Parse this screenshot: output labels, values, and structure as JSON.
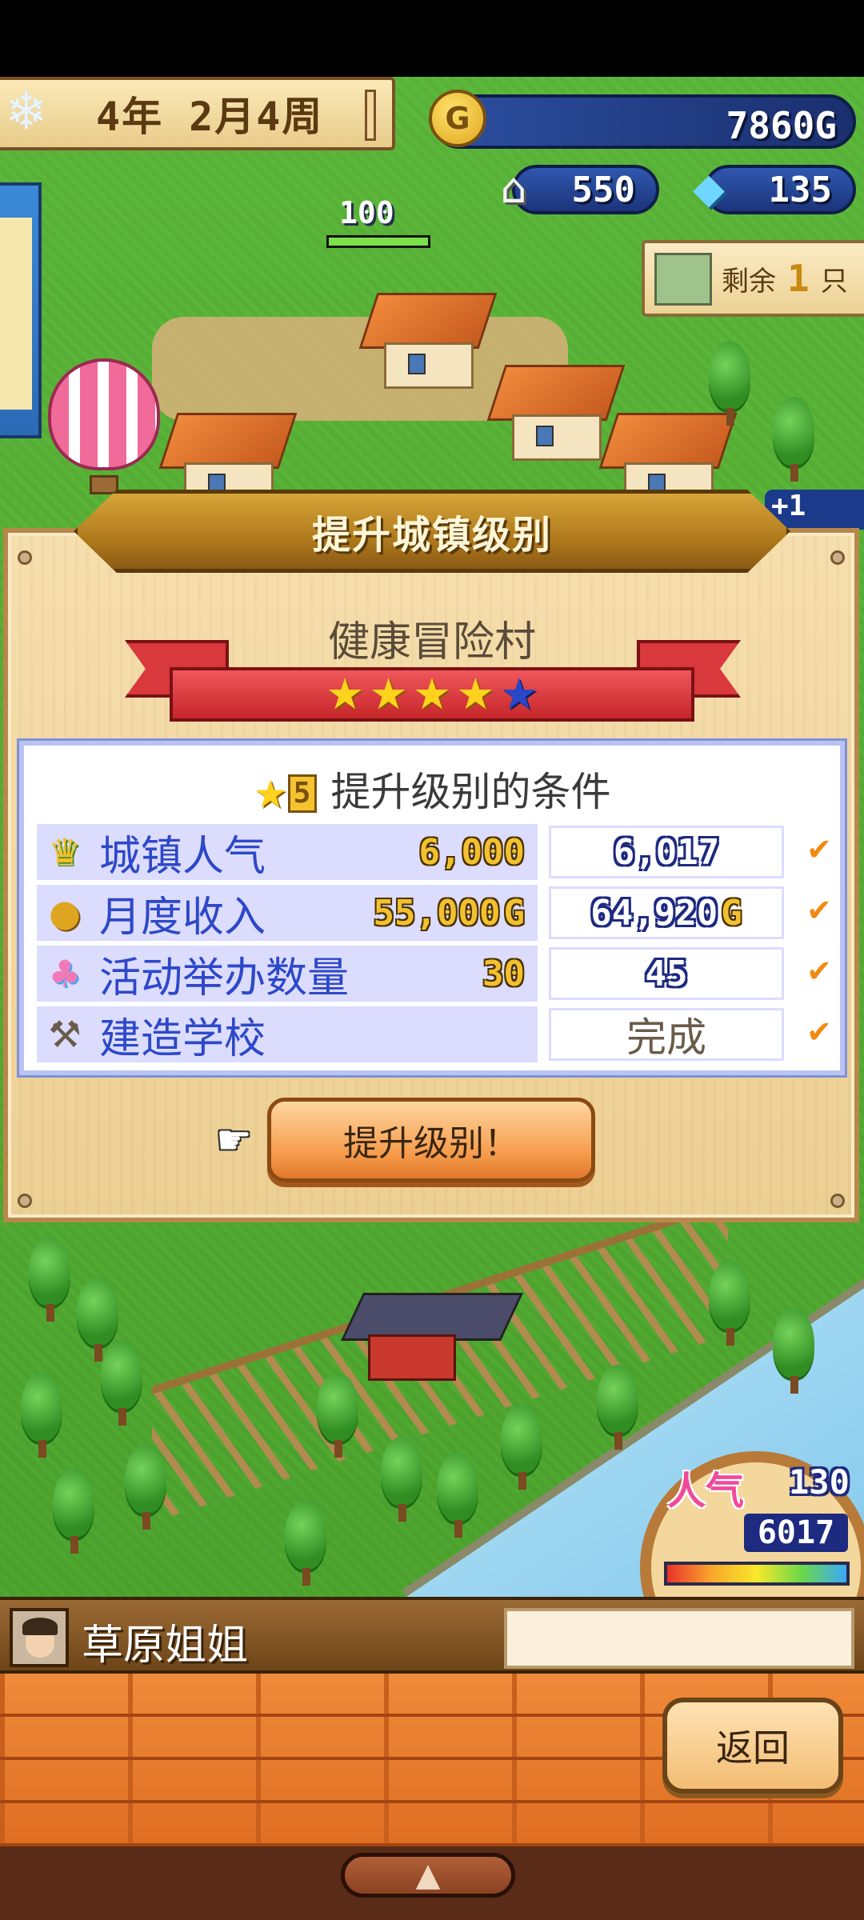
{
  "hud": {
    "date": "4年 2月4周",
    "gold_coin_symbol": "G",
    "gold": "7860G",
    "houses": "550",
    "crystals": "135",
    "popularity_small": "100",
    "remaining": {
      "label": "剩余",
      "count": "1",
      "unit": "只"
    },
    "plus_label": "+1"
  },
  "modal": {
    "title": "提升城镇级别",
    "town_name": "健康冒险村",
    "stars_filled": 4,
    "stars_total": 5,
    "conditions_star_level": "5",
    "conditions_header": "提升级别的条件",
    "conditions": [
      {
        "icon": "trophy-icon",
        "label": "城镇人气",
        "required": "6,000",
        "current": "6,017",
        "met": true
      },
      {
        "icon": "coin-icon",
        "label": "月度收入",
        "required": "55,000",
        "required_unit": "G",
        "current": "64,920",
        "current_unit": "G",
        "met": true
      },
      {
        "icon": "balloons-icon",
        "label": "活动举办数量",
        "required": "30",
        "current": "45",
        "met": true
      },
      {
        "icon": "hammer-icon",
        "label": "建造学校",
        "required": "",
        "current": "完成",
        "met": true
      }
    ],
    "upgrade_button": "提升级别！"
  },
  "popularity_badge": {
    "title": "人气",
    "rank": "130",
    "value": "6017"
  },
  "character": {
    "name": "草原姐姐",
    "message": ""
  },
  "back_button": "返回",
  "colors": {
    "accent_gold": "#f2c030",
    "label_blue": "#2d48c8",
    "ribbon_red": "#d9383c",
    "check_orange": "#f08a10"
  }
}
